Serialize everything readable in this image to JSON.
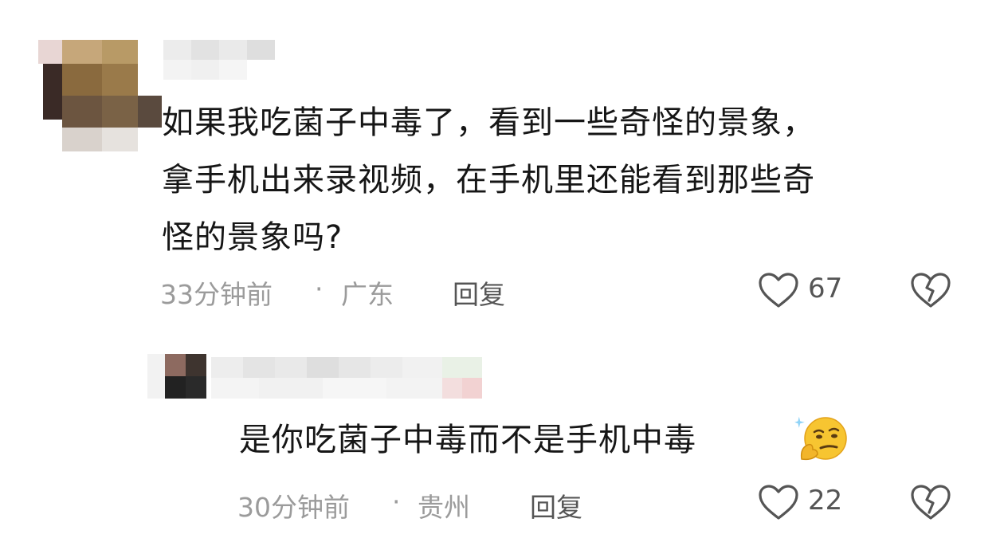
{
  "comments": [
    {
      "text_lines": [
        "如果我吃菌子中毒了，看到一些奇怪的景象，",
        "拿手机出来录视频，在手机里还能看到那些奇",
        "怪的景象吗?"
      ],
      "time": "33分钟前",
      "separator": "·",
      "location": "广东",
      "reply_label": "回复",
      "likes": "67"
    },
    {
      "text": "是你吃菌子中毒而不是手机中毒",
      "emoji": "thinking-face-emoji",
      "time": "30分钟前",
      "separator": "·",
      "location": "贵州",
      "reply_label": "回复",
      "likes": "22"
    }
  ],
  "colors": {
    "text": "#161616",
    "meta": "#9b9b9b",
    "icon": "#555555"
  },
  "icons": [
    "heart-icon",
    "broken-heart-icon"
  ]
}
